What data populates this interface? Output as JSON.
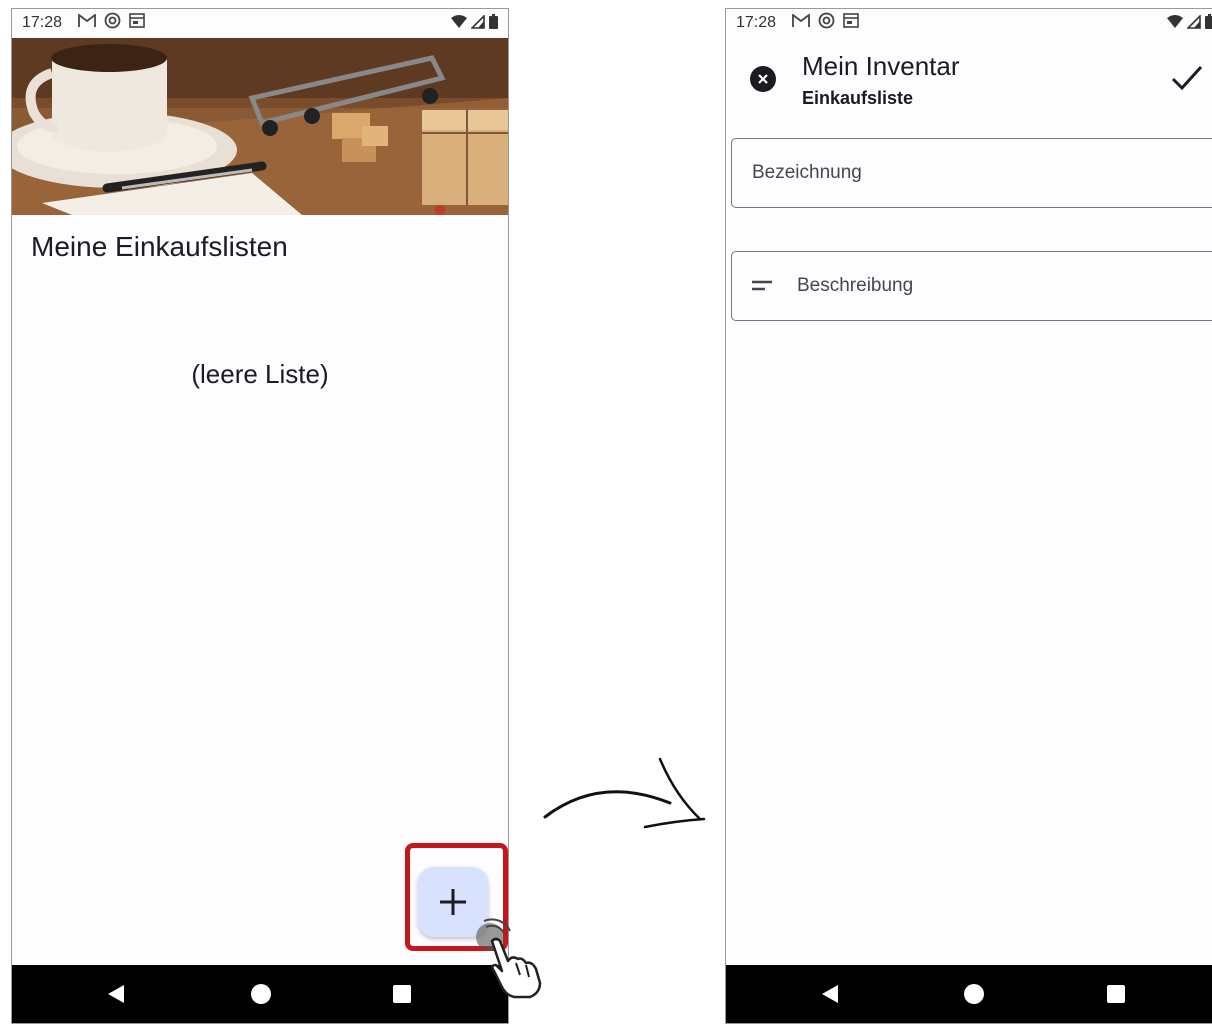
{
  "left_screen": {
    "status": {
      "time": "17:28"
    },
    "title": "Meine Einkaufslisten",
    "empty_text": "(leere Liste)",
    "fab_symbol": "+",
    "highlight_color": "#c4161c",
    "fab_color": "#d8e2ff"
  },
  "right_screen": {
    "status": {
      "time": "17:28"
    },
    "appbar": {
      "title": "Mein Inventar",
      "subtitle": "Einkaufsliste"
    },
    "fields": {
      "name_placeholder": "Bezeichnung",
      "description_placeholder": "Beschreibung"
    }
  },
  "icons": [
    "gmail-icon",
    "sync-icon",
    "calendar-icon",
    "wifi-icon",
    "signal-icon",
    "battery-icon",
    "close-icon",
    "check-icon",
    "notes-icon",
    "back-icon",
    "home-icon",
    "recents-icon",
    "hand-pointer-icon",
    "curved-arrow-icon"
  ]
}
